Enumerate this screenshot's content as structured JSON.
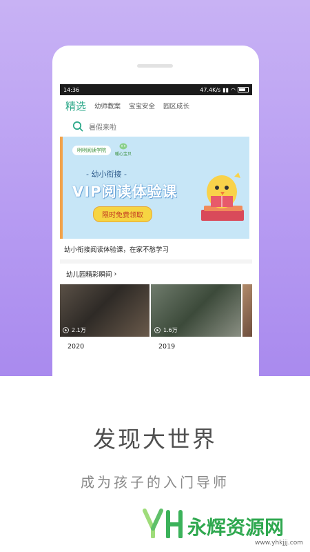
{
  "status_bar": {
    "time": "14:36",
    "speed": "47.4K/s"
  },
  "tabs": [
    "精选",
    "幼师教案",
    "宝宝安全",
    "园区成长"
  ],
  "search": {
    "placeholder": "暑假来啦"
  },
  "banner": {
    "brand": "咧咧阅读学院",
    "partner": "暖心宝贝",
    "subtitle": "- 幼小衔接 -",
    "title": "VIP阅读体验课",
    "cta": "限时免费领取",
    "caption": "幼小衔接阅读体验课，在家不愁学习"
  },
  "section": {
    "title": "幼儿园精彩瞬间",
    "chevron": "›"
  },
  "videos": [
    {
      "views": "2.1万",
      "year": "2020"
    },
    {
      "views": "1.6万",
      "year": "2019"
    }
  ],
  "promo": {
    "headline": "发现大世界",
    "tagline": "成为孩子的入门导师"
  },
  "watermark": {
    "name": "永辉资源网",
    "url": "www.yhkjjj.com"
  },
  "colors": {
    "accent": "#2ea98a",
    "background_top": "#b79cf2"
  }
}
